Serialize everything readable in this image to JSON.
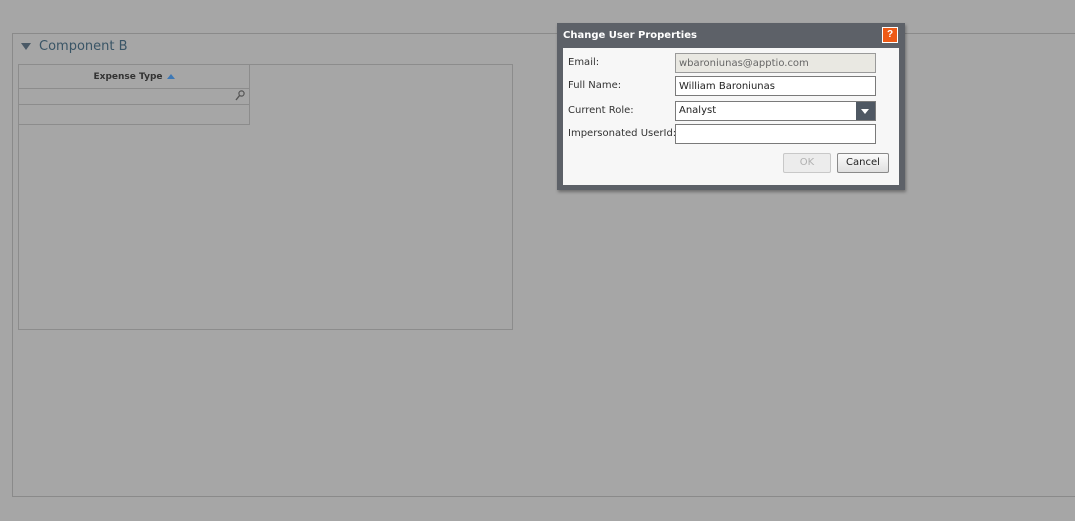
{
  "background_panel": {
    "title": "Component B",
    "grid": {
      "column_header": "Expense Type",
      "sort_direction": "ascending",
      "filter_value": ""
    }
  },
  "dialog": {
    "title": "Change User Properties",
    "help_label": "?",
    "fields": {
      "email": {
        "label": "Email:",
        "value": "wbaroniunas@apptio.com"
      },
      "full_name": {
        "label": "Full Name:",
        "value": "William Baroniunas"
      },
      "current_role": {
        "label": "Current Role:",
        "value": "Analyst"
      },
      "impersonated_userid": {
        "label": "Impersonated UserId:",
        "value": ""
      }
    },
    "buttons": {
      "ok": "OK",
      "cancel": "Cancel"
    }
  },
  "colors": {
    "overlay_background": "#a6a6a6",
    "dialog_frame": "#5d6168",
    "help_accent": "#ee5a16",
    "panel_title": "#3a5566"
  }
}
